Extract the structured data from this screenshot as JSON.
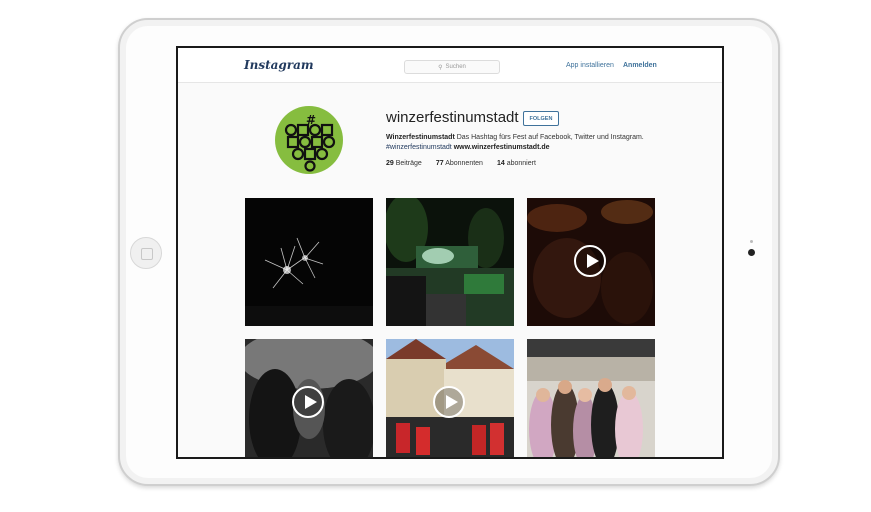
{
  "header": {
    "logo": "Instagram",
    "search_placeholder": "Suchen",
    "app_install": "App installieren",
    "login": "Anmelden"
  },
  "profile": {
    "username": "winzerfestinumstadt",
    "follow_label": "FOLGEN",
    "bio_name": "Winzerfestinumstadt",
    "bio_text": " Das Hashtag fürs Fest auf Facebook, Twitter und Instagram.",
    "hashtag": "#winzerfestinumstadt",
    "website": "www.winzerfestinumstadt.de",
    "stats": [
      {
        "count": "29",
        "label": "Beiträge"
      },
      {
        "count": "77",
        "label": "Abonnenten"
      },
      {
        "count": "14",
        "label": "abonniert"
      }
    ]
  },
  "posts": [
    {
      "kind": "photo",
      "subject": "fireworks"
    },
    {
      "kind": "photo",
      "subject": "concert-stage"
    },
    {
      "kind": "video",
      "subject": "crowd-night"
    },
    {
      "kind": "video",
      "subject": "crowd-bw"
    },
    {
      "kind": "video",
      "subject": "band-parade"
    },
    {
      "kind": "photo",
      "subject": "group-photo"
    }
  ],
  "colors": {
    "link_blue": "#3f729b",
    "avatar_green": "#86bd3f"
  }
}
